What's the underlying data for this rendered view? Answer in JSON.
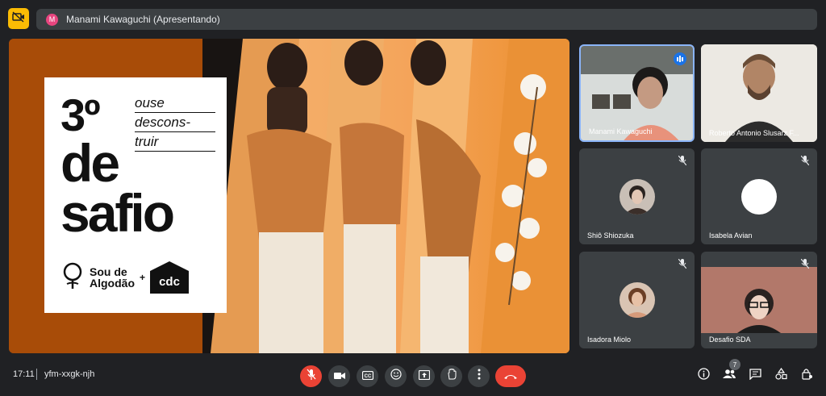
{
  "top_bar": {
    "presenter_initial": "M",
    "presenter_label": "Manami Kawaguchi (Apresentando)"
  },
  "slide": {
    "number": "3º",
    "title_line1": "de",
    "title_line2": "safio",
    "tagline": [
      "ouse",
      "descons-",
      "truir"
    ],
    "brand_line1": "Sou de",
    "brand_line2": "Algodão",
    "plus": "+",
    "brand_cdc": "cdc"
  },
  "participants": [
    {
      "name": "Manami Kawaguchi",
      "state": "speaking"
    },
    {
      "name": "Roberto Antonio Slusarz F...",
      "state": "video"
    },
    {
      "name": "Shiô Shiozuka",
      "state": "muted"
    },
    {
      "name": "Isabela Avian",
      "state": "muted"
    },
    {
      "name": "Isadora Miolo",
      "state": "muted"
    },
    {
      "name": "Desafio SDA",
      "state": "muted"
    }
  ],
  "bottom_bar": {
    "time": "17:11",
    "meeting_code": "yfm-xxgk-njh",
    "participant_count": "7"
  },
  "colors": {
    "background": "#202124",
    "tile": "#3c4043",
    "red": "#ea4335",
    "accent_blue": "#1a73e8",
    "camera_off": "#fbbc04"
  }
}
